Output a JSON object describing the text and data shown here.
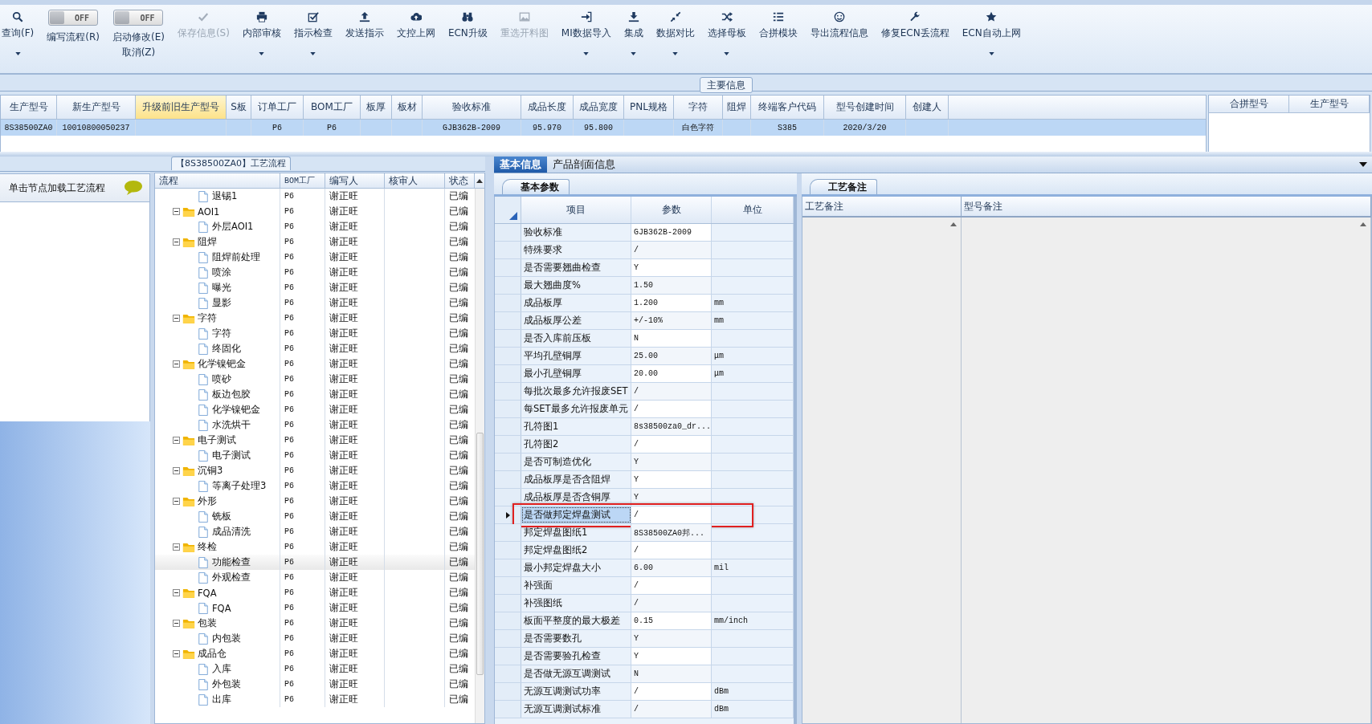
{
  "toolbar": {
    "items": [
      {
        "kind": "button",
        "label": "查询(F)",
        "disabled": false,
        "dropdown": true
      },
      {
        "kind": "toggle",
        "label": "编写流程(R)",
        "switch": "OFF",
        "on": false
      },
      {
        "kind": "toggle",
        "label": "启动修改(E)",
        "switch": "OFF",
        "on": false,
        "sublabel": "取消(Z)"
      },
      {
        "kind": "button",
        "label": "保存信息(S)",
        "disabled": true,
        "dropdown": false
      },
      {
        "kind": "button",
        "label": "内部审核",
        "disabled": false,
        "dropdown": true
      },
      {
        "kind": "button",
        "label": "指示检查",
        "disabled": false,
        "dropdown": true
      },
      {
        "kind": "button",
        "label": "发送指示",
        "disabled": false,
        "dropdown": false
      },
      {
        "kind": "button",
        "label": "文控上网",
        "disabled": false,
        "dropdown": false
      },
      {
        "kind": "button",
        "label": "ECN升级",
        "disabled": false,
        "dropdown": false
      },
      {
        "kind": "button",
        "label": "重选开料图",
        "disabled": true,
        "dropdown": false
      },
      {
        "kind": "button",
        "label": "MI数据导入",
        "disabled": false,
        "dropdown": true
      },
      {
        "kind": "button",
        "label": "集成",
        "disabled": false,
        "dropdown": true
      },
      {
        "kind": "button",
        "label": "数据对比",
        "disabled": false,
        "dropdown": true
      },
      {
        "kind": "button",
        "label": "选择母板",
        "disabled": false,
        "dropdown": true
      },
      {
        "kind": "button",
        "label": "合拼模块",
        "disabled": false,
        "dropdown": false
      },
      {
        "kind": "button",
        "label": "导出流程信息",
        "disabled": false,
        "dropdown": false
      },
      {
        "kind": "button",
        "label": "修复ECN丢流程",
        "disabled": false,
        "dropdown": false
      },
      {
        "kind": "button",
        "label": "ECN自动上网",
        "disabled": false,
        "dropdown": true
      }
    ]
  },
  "main_info": {
    "title": "主要信息",
    "columns": [
      {
        "label": "生产型号",
        "highlighted": false
      },
      {
        "label": "新生产型号",
        "highlighted": false
      },
      {
        "label": "升级前旧生产型号",
        "highlighted": true
      },
      {
        "label": "S板",
        "highlighted": false
      },
      {
        "label": "订单工厂",
        "highlighted": false
      },
      {
        "label": "BOM工厂",
        "highlighted": false
      },
      {
        "label": "板厚",
        "highlighted": false
      },
      {
        "label": "板材",
        "highlighted": false
      },
      {
        "label": "验收标准",
        "highlighted": false
      },
      {
        "label": "成品长度",
        "highlighted": false
      },
      {
        "label": "成品宽度",
        "highlighted": false
      },
      {
        "label": "PNL规格",
        "highlighted": false
      },
      {
        "label": "字符",
        "highlighted": false
      },
      {
        "label": "阻焊",
        "highlighted": false
      },
      {
        "label": "终端客户代码",
        "highlighted": false
      },
      {
        "label": "型号创建时间",
        "highlighted": false
      },
      {
        "label": "创建人",
        "highlighted": false
      }
    ],
    "rows": [
      {
        "selected": true,
        "cells": [
          "8S38500ZA0",
          "10010800050237",
          null,
          null,
          "P6",
          "P6",
          null,
          null,
          "GJB362B-2009",
          "95.970",
          "95.800",
          null,
          "白色字符",
          null,
          "S385",
          "2020/3/20",
          null
        ]
      }
    ],
    "merge_columns": [
      "合拼型号",
      "生产型号"
    ]
  },
  "left_panel": {
    "hint": "单击节点加载工艺流程"
  },
  "process_tree": {
    "title": "【8S38500ZA0】工艺流程",
    "columns": [
      "流程",
      "BOM工厂",
      "编写人",
      "核审人",
      "状态"
    ],
    "items": [
      {
        "kind": "file",
        "name": "退锡1",
        "bom": "P6",
        "writer": "谢正旺",
        "status": "已编",
        "selected": false
      },
      {
        "kind": "folder",
        "name": "AOI1",
        "bom": "P6",
        "writer": "谢正旺",
        "status": "已编",
        "selected": false,
        "expanded": true,
        "children": [
          {
            "kind": "file",
            "name": "外层AOI1",
            "bom": "P6",
            "writer": "谢正旺",
            "status": "已编",
            "selected": false
          }
        ]
      },
      {
        "kind": "folder",
        "name": "阻焊",
        "bom": "P6",
        "writer": "谢正旺",
        "status": "已编",
        "selected": false,
        "expanded": true,
        "children": [
          {
            "kind": "file",
            "name": "阻焊前处理",
            "bom": "P6",
            "writer": "谢正旺",
            "status": "已编",
            "selected": false
          },
          {
            "kind": "file",
            "name": "喷涂",
            "bom": "P6",
            "writer": "谢正旺",
            "status": "已编",
            "selected": false
          },
          {
            "kind": "file",
            "name": "曝光",
            "bom": "P6",
            "writer": "谢正旺",
            "status": "已编",
            "selected": false
          },
          {
            "kind": "file",
            "name": "显影",
            "bom": "P6",
            "writer": "谢正旺",
            "status": "已编",
            "selected": false
          }
        ]
      },
      {
        "kind": "folder",
        "name": "字符",
        "bom": "P6",
        "writer": "谢正旺",
        "status": "已编",
        "selected": false,
        "expanded": true,
        "children": [
          {
            "kind": "file",
            "name": "字符",
            "bom": "P6",
            "writer": "谢正旺",
            "status": "已编",
            "selected": false
          },
          {
            "kind": "file",
            "name": "终固化",
            "bom": "P6",
            "writer": "谢正旺",
            "status": "已编",
            "selected": false
          }
        ]
      },
      {
        "kind": "folder",
        "name": "化学镍钯金",
        "bom": "P6",
        "writer": "谢正旺",
        "status": "已编",
        "selected": false,
        "expanded": true,
        "children": [
          {
            "kind": "file",
            "name": "喷砂",
            "bom": "P6",
            "writer": "谢正旺",
            "status": "已编",
            "selected": false
          },
          {
            "kind": "file",
            "name": "板边包胶",
            "bom": "P6",
            "writer": "谢正旺",
            "status": "已编",
            "selected": false
          },
          {
            "kind": "file",
            "name": "化学镍钯金",
            "bom": "P6",
            "writer": "谢正旺",
            "status": "已编",
            "selected": false
          },
          {
            "kind": "file",
            "name": "水洗烘干",
            "bom": "P6",
            "writer": "谢正旺",
            "status": "已编",
            "selected": false
          }
        ]
      },
      {
        "kind": "folder",
        "name": "电子测试",
        "bom": "P6",
        "writer": "谢正旺",
        "status": "已编",
        "selected": false,
        "expanded": true,
        "children": [
          {
            "kind": "file",
            "name": "电子测试",
            "bom": "P6",
            "writer": "谢正旺",
            "status": "已编",
            "selected": false
          }
        ]
      },
      {
        "kind": "folder",
        "name": "沉铜3",
        "bom": "P6",
        "writer": "谢正旺",
        "status": "已编",
        "selected": false,
        "expanded": true,
        "children": [
          {
            "kind": "file",
            "name": "等离子处理3",
            "bom": "P6",
            "writer": "谢正旺",
            "status": "已编",
            "selected": false
          }
        ]
      },
      {
        "kind": "folder",
        "name": "外形",
        "bom": "P6",
        "writer": "谢正旺",
        "status": "已编",
        "selected": false,
        "expanded": true,
        "children": [
          {
            "kind": "file",
            "name": "铣板",
            "bom": "P6",
            "writer": "谢正旺",
            "status": "已编",
            "selected": false
          },
          {
            "kind": "file",
            "name": "成品清洗",
            "bom": "P6",
            "writer": "谢正旺",
            "status": "已编",
            "selected": false
          }
        ]
      },
      {
        "kind": "folder",
        "name": "终检",
        "bom": "P6",
        "writer": "谢正旺",
        "status": "已编",
        "selected": false,
        "expanded": true,
        "children": [
          {
            "kind": "file",
            "name": "功能检查",
            "bom": "P6",
            "writer": "谢正旺",
            "status": "已编",
            "selected": true
          },
          {
            "kind": "file",
            "name": "外观检查",
            "bom": "P6",
            "writer": "谢正旺",
            "status": "已编",
            "selected": false
          }
        ]
      },
      {
        "kind": "folder",
        "name": "FQA",
        "bom": "P6",
        "writer": "谢正旺",
        "status": "已编",
        "selected": false,
        "expanded": true,
        "children": [
          {
            "kind": "file",
            "name": "FQA",
            "bom": "P6",
            "writer": "谢正旺",
            "status": "已编",
            "selected": false
          }
        ]
      },
      {
        "kind": "folder",
        "name": "包装",
        "bom": "P6",
        "writer": "谢正旺",
        "status": "已编",
        "selected": false,
        "expanded": true,
        "children": [
          {
            "kind": "file",
            "name": "内包装",
            "bom": "P6",
            "writer": "谢正旺",
            "status": "已编",
            "selected": false
          }
        ]
      },
      {
        "kind": "folder",
        "name": "成品仓",
        "bom": "P6",
        "writer": "谢正旺",
        "status": "已编",
        "selected": false,
        "expanded": true,
        "children": [
          {
            "kind": "file",
            "name": "入库",
            "bom": "P6",
            "writer": "谢正旺",
            "status": "已编",
            "selected": false
          },
          {
            "kind": "file",
            "name": "外包装",
            "bom": "P6",
            "writer": "谢正旺",
            "status": "已编",
            "selected": false
          },
          {
            "kind": "file",
            "name": "出库",
            "bom": "P6",
            "writer": "谢正旺",
            "status": "已编",
            "selected": false
          }
        ]
      }
    ]
  },
  "detail_tabs": [
    {
      "label": "基本信息",
      "selected": true
    },
    {
      "label": "产品剖面信息",
      "selected": false
    }
  ],
  "params": {
    "tab": "基本参数",
    "columns": [
      "项目",
      "参数",
      "单位"
    ],
    "rows": [
      {
        "item": "验收标准",
        "value": "GJB362B-2009",
        "selected": false,
        "outlined": false
      },
      {
        "item": "特殊要求",
        "value": "/",
        "selected": false,
        "outlined": false
      },
      {
        "item": "是否需要翘曲检查",
        "value": "Y",
        "selected": false,
        "outlined": false
      },
      {
        "item": "最大翘曲度%",
        "value": "1.50",
        "selected": false,
        "outlined": false
      },
      {
        "item": "成品板厚",
        "value": "1.200",
        "unit": "mm",
        "selected": false,
        "outlined": false
      },
      {
        "item": "成品板厚公差",
        "value": "+/-10%",
        "unit": "mm",
        "selected": false,
        "outlined": false
      },
      {
        "item": "是否入库前压板",
        "value": "N",
        "selected": false,
        "outlined": false
      },
      {
        "item": "平均孔壁铜厚",
        "value": "25.00",
        "unit": "μm",
        "selected": false,
        "outlined": false
      },
      {
        "item": "最小孔壁铜厚",
        "value": "20.00",
        "unit": "μm",
        "selected": false,
        "outlined": false
      },
      {
        "item": "每批次最多允许报废SET",
        "value": "/",
        "selected": false,
        "outlined": false
      },
      {
        "item": "每SET最多允许报废单元",
        "value": "/",
        "selected": false,
        "outlined": false
      },
      {
        "item": "孔符图1",
        "value": "8s38500za0_dr...",
        "selected": false,
        "outlined": false
      },
      {
        "item": "孔符图2",
        "value": "/",
        "selected": false,
        "outlined": false
      },
      {
        "item": "是否可制造优化",
        "value": "Y",
        "selected": false,
        "outlined": false
      },
      {
        "item": "成品板厚是否含阻焊",
        "value": "Y",
        "selected": false,
        "outlined": false
      },
      {
        "item": "成品板厚是否含铜厚",
        "value": "Y",
        "selected": false,
        "outlined": false
      },
      {
        "item": "是否做邦定焊盘测试",
        "value": "/",
        "selected": true,
        "outlined": true
      },
      {
        "item": "邦定焊盘图纸1",
        "value": "8S38500ZA0邦...",
        "selected": false,
        "outlined": false
      },
      {
        "item": "邦定焊盘图纸2",
        "value": "/",
        "selected": false,
        "outlined": false
      },
      {
        "item": "最小邦定焊盘大小",
        "value": "6.00",
        "unit": "mil",
        "selected": false,
        "outlined": false
      },
      {
        "item": "补强面",
        "value": "/",
        "selected": false,
        "outlined": false
      },
      {
        "item": "补强图纸",
        "value": "/",
        "selected": false,
        "outlined": false
      },
      {
        "item": "板面平整度的最大极差",
        "value": "0.15",
        "unit": "mm/inch",
        "selected": false,
        "outlined": false
      },
      {
        "item": "是否需要数孔",
        "value": "Y",
        "selected": false,
        "outlined": false
      },
      {
        "item": "是否需要验孔检查",
        "value": "Y",
        "selected": false,
        "outlined": false
      },
      {
        "item": "是否做无源互调测试",
        "value": "N",
        "selected": false,
        "outlined": false
      },
      {
        "item": "无源互调测试功率",
        "value": "/",
        "unit": "dBm",
        "selected": false,
        "outlined": false
      },
      {
        "item": "无源互调测试标准",
        "value": "/",
        "unit": "dBm",
        "selected": false,
        "outlined": false
      }
    ]
  },
  "notes": {
    "tab": "工艺备注",
    "columns": [
      "工艺备注",
      "型号备注"
    ]
  }
}
